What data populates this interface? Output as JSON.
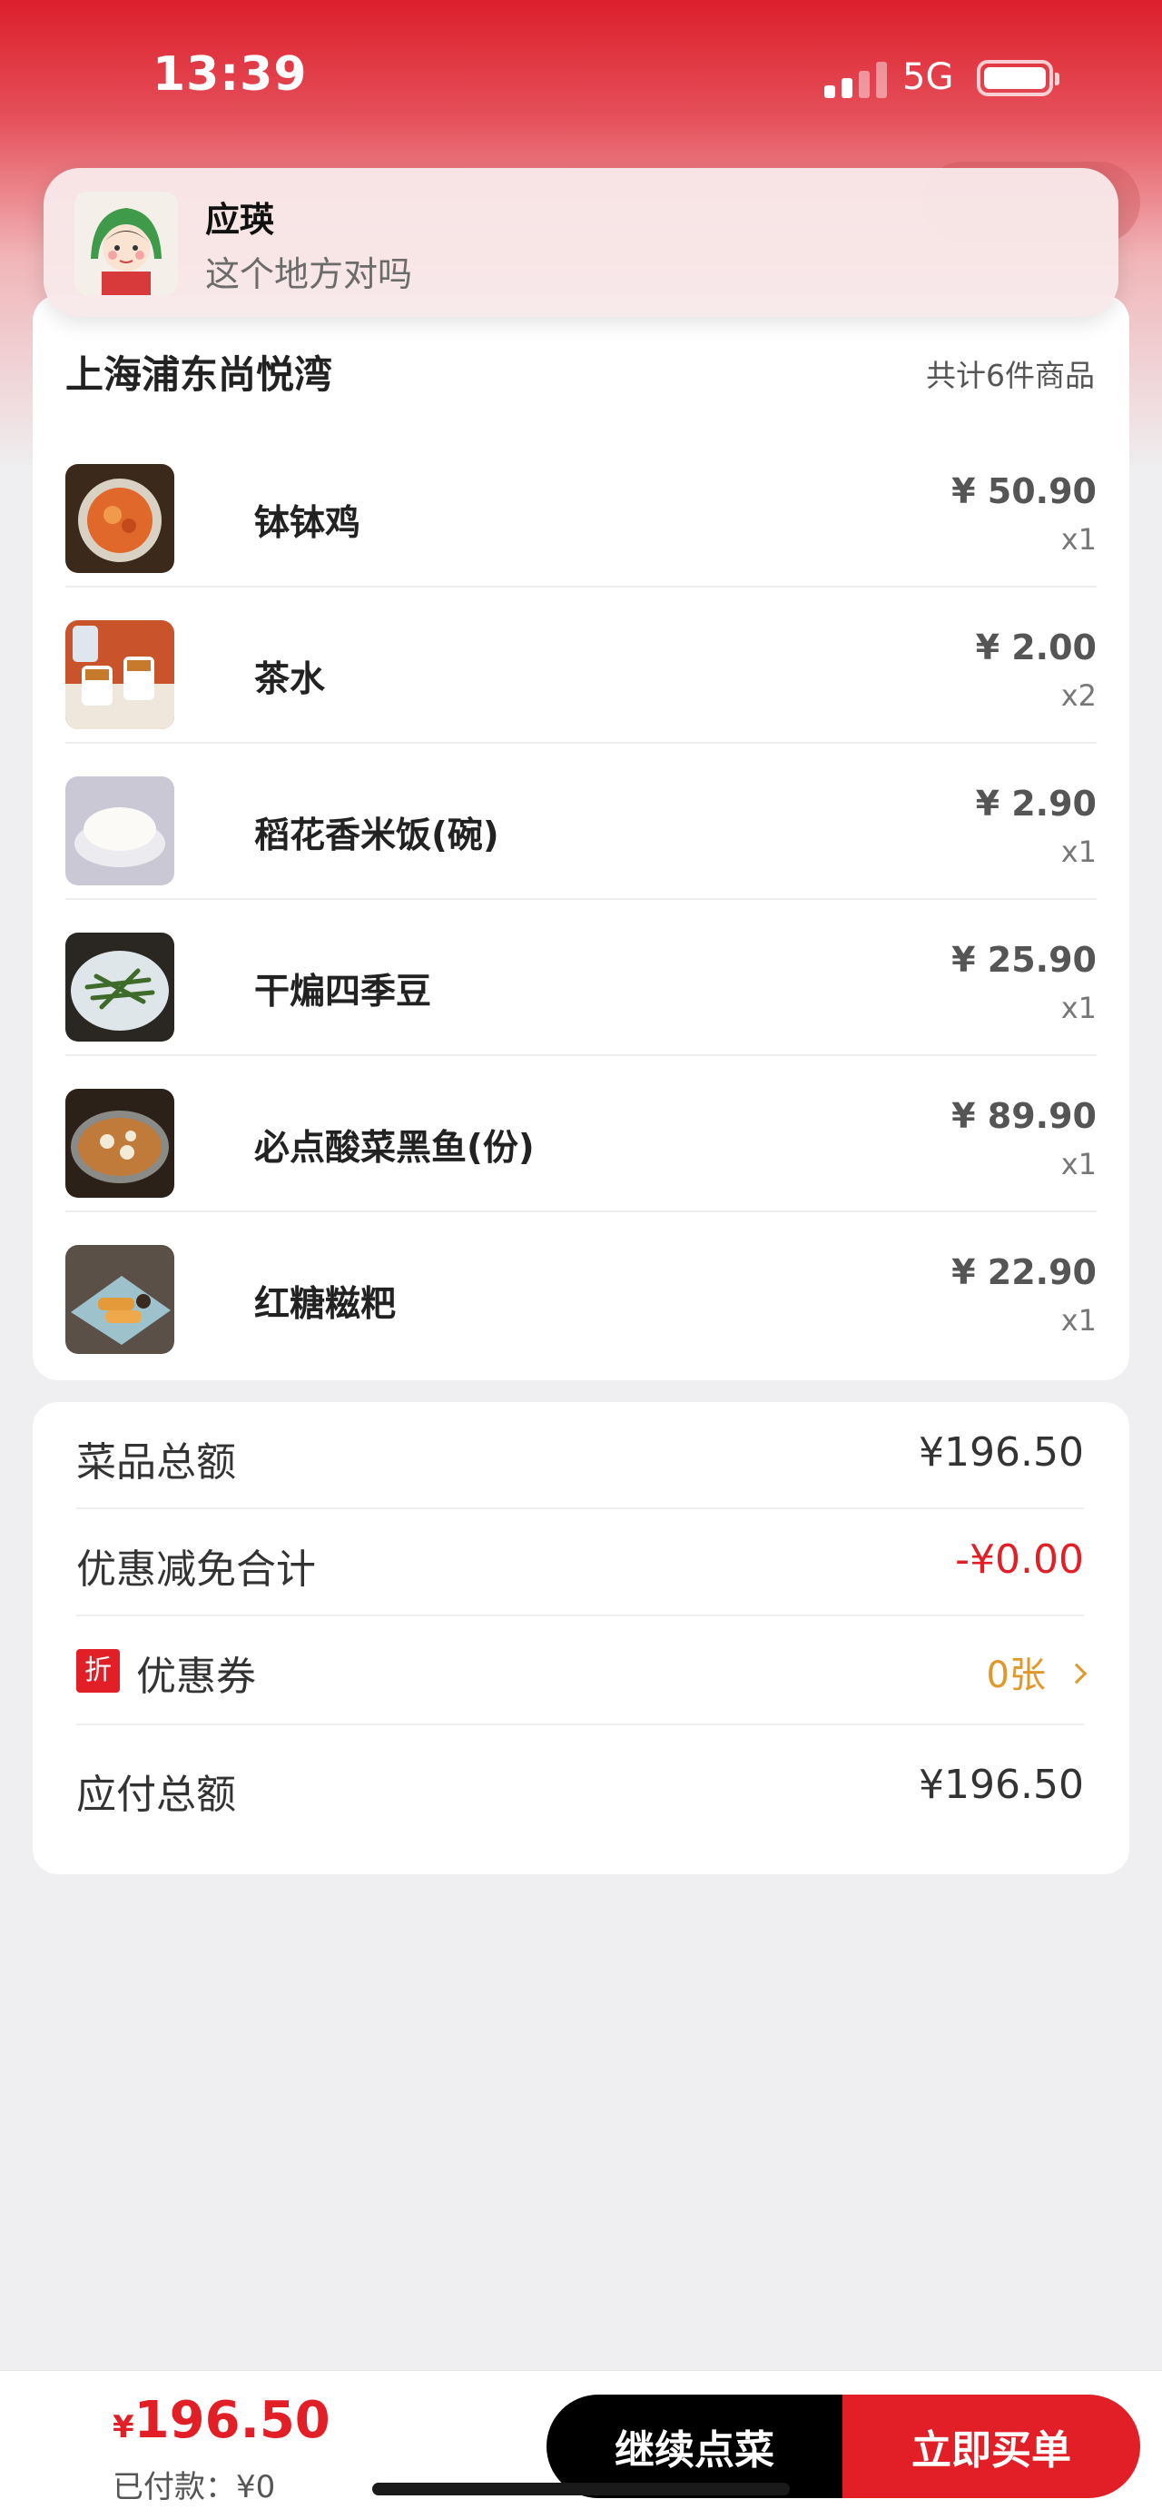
{
  "status_bar": {
    "time": "13:39",
    "network": "5G"
  },
  "notification": {
    "sender": "应瑛",
    "message": "这个地方对吗"
  },
  "order": {
    "store_name": "上海浦东尚悦湾",
    "item_count": "共计6件商品",
    "items": [
      {
        "name": "钵钵鸡",
        "price": "¥ 50.90",
        "qty": "x1",
        "thumb_icon": "food-photo-bobo-chicken"
      },
      {
        "name": "茶水",
        "price": "¥ 2.00",
        "qty": "x2",
        "thumb_icon": "food-photo-tea"
      },
      {
        "name": "稻花香米饭(碗)",
        "price": "¥ 2.90",
        "qty": "x1",
        "thumb_icon": "food-photo-rice"
      },
      {
        "name": "干煸四季豆",
        "price": "¥ 25.90",
        "qty": "x1",
        "thumb_icon": "food-photo-green-beans"
      },
      {
        "name": "必点酸菜黑鱼(份)",
        "price": "¥ 89.90",
        "qty": "x1",
        "thumb_icon": "food-photo-fish"
      },
      {
        "name": "红糖糍粑",
        "price": "¥ 22.90",
        "qty": "x1",
        "thumb_icon": "food-photo-ciba"
      }
    ]
  },
  "summary": {
    "subtotal_label": "菜品总额",
    "subtotal_value": "¥196.50",
    "discount_label": "优惠减免合计",
    "discount_value": "-¥0.00",
    "coupon_tag": "折",
    "coupon_label": "优惠券",
    "coupon_value": "0张",
    "payable_label": "应付总额",
    "payable_value": "¥196.50"
  },
  "bottom_bar": {
    "currency": "¥",
    "total": "196.50",
    "paid": "已付款：¥0",
    "continue_label": "继续点菜",
    "checkout_label": "立即买单"
  },
  "colors": {
    "brand_red": "#e21e26",
    "coupon_orange": "#e0982a"
  }
}
